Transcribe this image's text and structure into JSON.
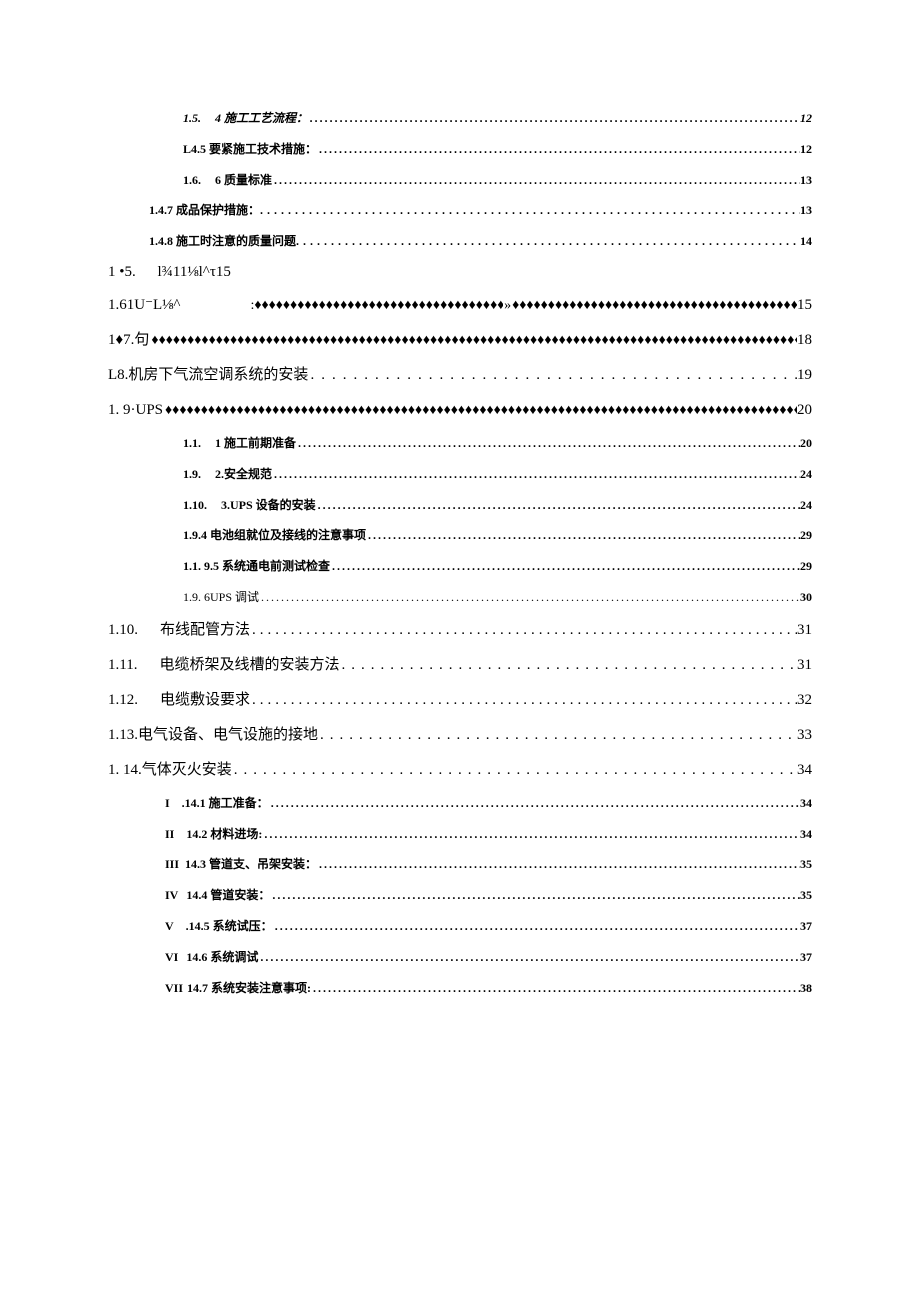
{
  "entries": [
    {
      "class": "lvl-a italic",
      "num": "1.5.",
      "title": "4 施工工艺流程：",
      "fill": "dots",
      "page": "12"
    },
    {
      "class": "lvl-a",
      "num": "",
      "title": "L4.5 要紧施工技术措施：",
      "fill": "dots",
      "page": "12"
    },
    {
      "class": "lvl-a",
      "num": "1.6.",
      "title": "6 质量标准",
      "fill": "dots",
      "page": "13"
    },
    {
      "class": "lvl-b",
      "num": "",
      "title": "1.4.7 成品保护措施：",
      "fill": "dots2",
      "page": "13"
    },
    {
      "class": "lvl-b",
      "num": "",
      "title": "1.4.8 施工时注意的质量问题",
      "fill": "dots2",
      "page": "14"
    }
  ],
  "row15": {
    "num": "1  •5.",
    "title": "l¾11⅛l^τ15"
  },
  "row16": {
    "left": "1.61U⁻L⅛^",
    "page": "15"
  },
  "row17": {
    "num": "1♦7.",
    "title": "句",
    "page": "18"
  },
  "rowL8": {
    "num": "L8.",
    "title": "机房下气流空调系统的安装",
    "page": "19"
  },
  "row19": {
    "num": "1.   9·",
    "title": "UPS",
    "page": "20"
  },
  "upsSub": [
    {
      "class": "lvl-a",
      "num": "1.1.",
      "title": "1 施工前期准备",
      "fill": "dots",
      "page": "20"
    },
    {
      "class": "lvl-a",
      "num": "1.9.",
      "title": "2.安全规范",
      "fill": "dots",
      "page": "24"
    },
    {
      "class": "lvl-a",
      "num": "1.10.",
      "title": "3.UPS 设备的安装",
      "fill": "dots",
      "page": "24"
    },
    {
      "class": "lvl-a",
      "num": "",
      "title": "1.9.4 电池组就位及接线的注意事项",
      "fill": "dots",
      "page": "29"
    },
    {
      "class": "lvl-a",
      "num": "",
      "title": "1.1. 9.5 系统通电前测试检查",
      "fill": "dots",
      "page": "29"
    },
    {
      "class": "lvl-a",
      "num": "",
      "title": "1.9. 6UPS 调试",
      "fill": "dots",
      "page": "30",
      "weight": "normal"
    }
  ],
  "main": [
    {
      "class": "lvl-1n",
      "num": "1.10.",
      "title": "布线配管方法",
      "page": "31"
    },
    {
      "class": "lvl-1n",
      "num": "1.11.",
      "title": "电缆桥架及线槽的安装方法",
      "page": "31"
    },
    {
      "class": "lvl-1n",
      "num": "1.12.",
      "title": "电缆敷设要求",
      "page": "32"
    },
    {
      "class": "lvl-1",
      "num": "1.13.",
      "title": "电气设备、电气设施的接地",
      "page": "33",
      "numspc": "4px"
    },
    {
      "class": "lvl-1",
      "num": "1.   14.",
      "title": "气体灭火安装",
      "page": "34",
      "numspc": "4px"
    }
  ],
  "roman": [
    {
      "num": "I",
      "title": ".14.1 施工准备：",
      "page": "34"
    },
    {
      "num": "II",
      "title": "14.2 材料进场:",
      "page": "34"
    },
    {
      "num": "III",
      "title": "14.3 管道支、吊架安装：",
      "page": "35"
    },
    {
      "num": "IV",
      "title": "14.4 管道安装：",
      "page": "35"
    },
    {
      "num": "V",
      "title": ".14.5 系统试压：",
      "page": "37"
    },
    {
      "num": "VI",
      "title": "14.6 系统调试",
      "page": "37"
    },
    {
      "num": "VII",
      "title": "14.7 系统安装注意事项:",
      "page": "38"
    }
  ]
}
